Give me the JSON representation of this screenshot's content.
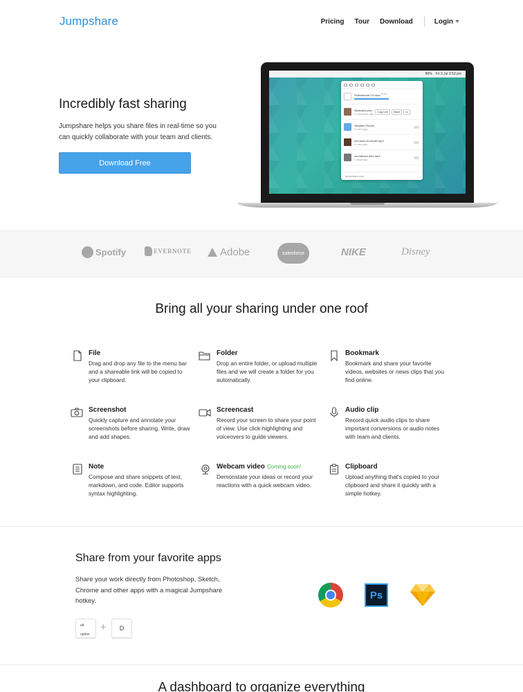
{
  "header": {
    "logo": "Jumpshare",
    "nav": [
      "Pricing",
      "Tour",
      "Download"
    ],
    "login": "Login"
  },
  "hero": {
    "title": "Incredibly fast sharing",
    "text": "Jumpshare helps you share files in real-time so you can quickly collaborate with your team and clients.",
    "button": "Download Free",
    "mock": {
      "menubar_items": [
        "80%",
        "Fri 3 Jul  3:53 pm"
      ],
      "rows": [
        {
          "name": "Professional CV.docx",
          "sub": "67%"
        },
        {
          "name": "illustration.psd",
          "sub": "21 seconds ago"
        },
        {
          "name": "Vacation Photos",
          "sub": "2 mins ago"
        },
        {
          "name": "iron-man-3d-model.mp4",
          "sub": "5 mins ago"
        },
        {
          "name": "soundtrack-intro.mp3",
          "sub": "2 days ago"
        }
      ],
      "row_buttons": [
        "Copy Link",
        "Share",
        "•••"
      ],
      "footer": "Jumpshare.com"
    }
  },
  "logos": [
    "Spotify",
    "EVERNOTE",
    "Adobe",
    "salesforce",
    "NIKE",
    "Disney"
  ],
  "features": {
    "title": "Bring all your sharing under one roof",
    "items": [
      {
        "title": "File",
        "desc": "Drag and drop any file to the menu bar and a shareable link will be copied to your clipboard.",
        "icon": "file-icon"
      },
      {
        "title": "Folder",
        "desc": "Drop an entire folder, or upload multiple files and we will create a folder for you automatically.",
        "icon": "folder-icon"
      },
      {
        "title": "Bookmark",
        "desc": "Bookmark and share your favorite videos, websites or news clips that you find online.",
        "icon": "bookmark-icon"
      },
      {
        "title": "Screenshot",
        "desc": "Quickly capture and annotate your screenshots before sharing. Write, draw and add shapes.",
        "icon": "camera-icon"
      },
      {
        "title": "Screencast",
        "desc": "Record your screen to share your point of view. Use click-highlighting and voiceovers to guide viewers.",
        "icon": "video-camera-icon"
      },
      {
        "title": "Audio clip",
        "desc": "Record quick audio clips to share important conversions or audio notes with team and clients.",
        "icon": "microphone-icon"
      },
      {
        "title": "Note",
        "desc": "Compose and share snippets of text, markdown, and code. Editor supports syntax highlighting.",
        "icon": "note-icon"
      },
      {
        "title": "Webcam video",
        "badge": "Coming soon!",
        "desc": "Demonstate your ideas or record your reactions with a quick webcam video.",
        "icon": "webcam-icon"
      },
      {
        "title": "Clipboard",
        "desc": "Upload anything that's copied to your clipboard and share it quickly with a simple hotkey.",
        "icon": "clipboard-icon"
      }
    ]
  },
  "apps": {
    "title": "Share from your favorite apps",
    "text": "Share your work directly from Photoshop, Sketch, Chrome and other apps with a magical Jumpshare hotkey.",
    "key_alt_top": "alt",
    "key_alt_bottom": "option",
    "plus": "+",
    "key_d": "D",
    "icons": [
      "chrome-icon",
      "photoshop-icon",
      "sketch-icon"
    ],
    "ps_label": "Ps"
  },
  "dashboard": {
    "title": "A dashboard to organize everything"
  }
}
